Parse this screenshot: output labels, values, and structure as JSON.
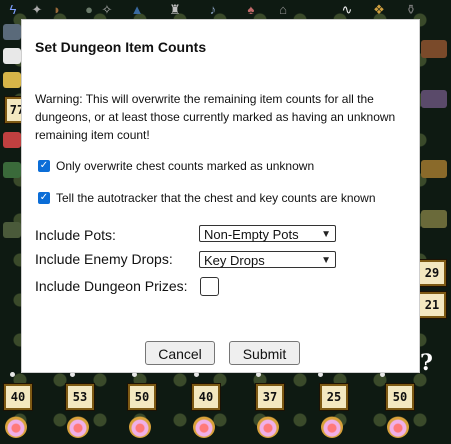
{
  "dialog": {
    "title": "Set Dungeon Item Counts",
    "warning": "Warning: This will overwrite the remaining item counts for all the dungeons, or at least those currently marked as having an unknown remaining item count!",
    "checkboxes": [
      {
        "label": "Only overwrite chest counts marked as unknown",
        "checked": true
      },
      {
        "label": "Tell the autotracker that the chest and key counts are known",
        "checked": true
      }
    ],
    "options": {
      "pots_label": "Include Pots:",
      "pots_value": "Non-Empty Pots",
      "drops_label": "Include Enemy Drops:",
      "drops_value": "Key Drops",
      "prizes_label": "Include Dungeon Prizes:",
      "prizes_checked": false
    },
    "buttons": {
      "cancel": "Cancel",
      "submit": "Submit"
    }
  },
  "tracker": {
    "left_count": "77",
    "right_counts": [
      "29",
      "21"
    ],
    "unknown_marker": "?",
    "dungeon_counts": [
      "40",
      "53",
      "50",
      "40",
      "37",
      "25",
      "50"
    ]
  },
  "colors": {
    "checkbox_accent": "#0b6dd7",
    "badge_fill": "#f3e8c0",
    "badge_border": "#7d5a14"
  }
}
